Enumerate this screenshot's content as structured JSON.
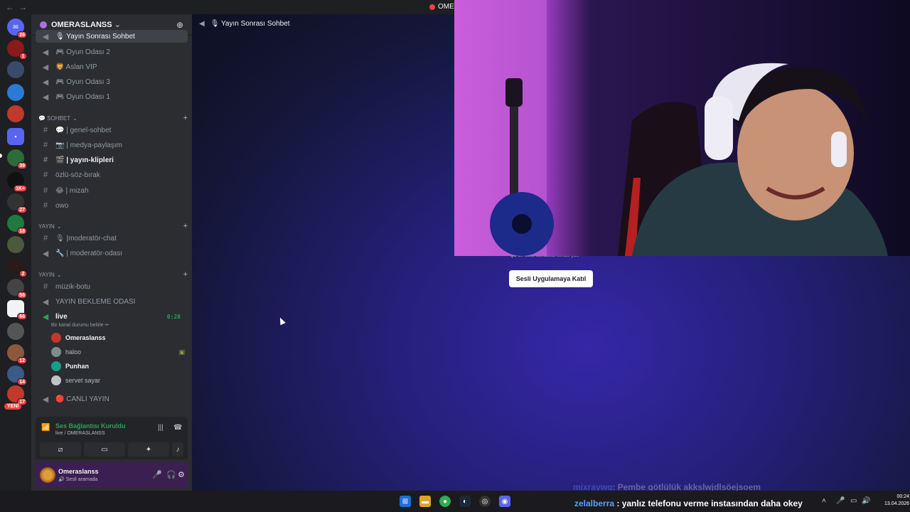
{
  "window": {
    "title": "OMER"
  },
  "server": {
    "name": "OMERASLANSS"
  },
  "channels_top": [
    {
      "name": "🎙 Yayın Sonrası Sohbet",
      "type": "voice"
    },
    {
      "name": "🎮 Oyun Odası 2",
      "type": "voice"
    },
    {
      "name": "🦁 Aslan VIP",
      "type": "voice"
    },
    {
      "name": "🎮 Oyun Odası 3",
      "type": "voice"
    },
    {
      "name": "🎮 Oyun Odası 1",
      "type": "voice"
    }
  ],
  "category_sohbet": {
    "label": "💬 SOHBET"
  },
  "channels_sohbet": [
    {
      "name": "💬 | genel-sohbet"
    },
    {
      "name": "📷 | medya-paylaşım"
    },
    {
      "name": "🎬 | yayın-klipleri"
    },
    {
      "name": "özlü-söz-bırak"
    },
    {
      "name": "😂 | mizah"
    },
    {
      "name": "owo"
    }
  ],
  "category_yayin1": {
    "label": "YAYIN"
  },
  "channels_yayin1": [
    {
      "name": "🎙 |moderatör-chat"
    },
    {
      "name": "🔧 | moderatör-odası"
    }
  ],
  "category_yayin2": {
    "label": "YAYIN"
  },
  "channels_yayin2": [
    {
      "name": "müzik-botu"
    },
    {
      "name": "YAYIN BEKLEME ODASI"
    },
    {
      "name": "live"
    },
    {
      "name": "🔴 CANLI YAYIN"
    }
  ],
  "live_timer": "0:28",
  "live_status": "Bir kanal durumu belirle ✏",
  "voice_users": [
    {
      "name": "Omeraslanss",
      "color": "#c0392b"
    },
    {
      "name": "haloo",
      "color": "#7f8c8d"
    },
    {
      "name": "Punhan",
      "color": "#16a085"
    },
    {
      "name": "servet sayar",
      "color": "#bdc3c7"
    }
  ],
  "voice_panel": {
    "status": "Ses Bağlantısı Kuruldu",
    "channel": "live / OMERASLANSS"
  },
  "user_panel": {
    "name": "Omeraslanss",
    "status": "🔊 Sesli aramada"
  },
  "main": {
    "channel_title": "🎙 Yayın Sonrası Sohbet",
    "hint": "Şu an sesli sohbette kimse yok",
    "join_label": "Sesli Uygulamaya Katıl"
  },
  "server_badges": [
    "26",
    "1",
    "39",
    "1K+",
    "27",
    "18",
    "2",
    "56",
    "66",
    "12",
    "14",
    "17"
  ],
  "new_label": "YENİ",
  "chat": [
    {
      "user": "mixraywq",
      "message": ": Pembe götlülük akkslwjdlsöejsoem"
    },
    {
      "user": "zelalberra",
      "message": " : yanlız telefonu verme instasından daha okey"
    }
  ],
  "clock": {
    "time": "00:24",
    "date": "13.04.2026"
  },
  "colors": {
    "accent": "#5865f2",
    "green": "#23a55a",
    "red": "#f23f43"
  }
}
